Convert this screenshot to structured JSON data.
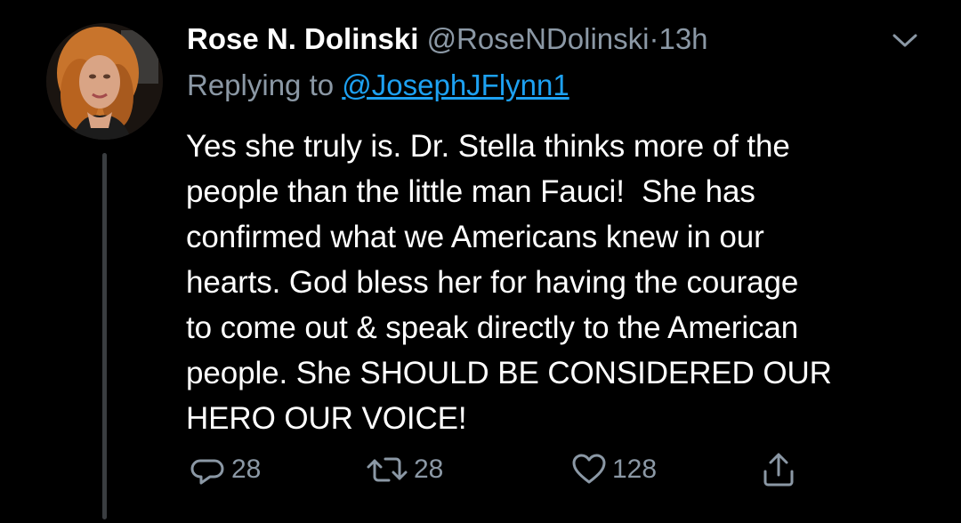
{
  "tweet": {
    "author_name": "Rose N. Dolinski",
    "author_handle": "@RoseNDolinski",
    "separator": "·",
    "time": "13h",
    "replying_prefix": "Replying to ",
    "replying_to": "@JosephJFlynn1",
    "text": "Yes she truly is. Dr. Stella thinks more of the\npeople than the little man Fauci!  She has\nconfirmed what we Americans knew in our\nhearts. God bless her for having the courage\nto come out & speak directly to the American\npeople. She SHOULD BE CONSIDERED OUR\nHERO OUR VOICE!",
    "actions": {
      "reply_count": "28",
      "retweet_count": "28",
      "like_count": "128"
    }
  },
  "icons": {
    "avatar": "avatar",
    "caret": "chevron-down-icon",
    "reply": "reply-icon",
    "retweet": "retweet-icon",
    "like": "heart-icon",
    "share": "share-icon"
  },
  "colors": {
    "background": "#000000",
    "text": "#ffffff",
    "muted": "#8b98a5",
    "link": "#1da1f2",
    "thread_line": "#3a3d40"
  }
}
